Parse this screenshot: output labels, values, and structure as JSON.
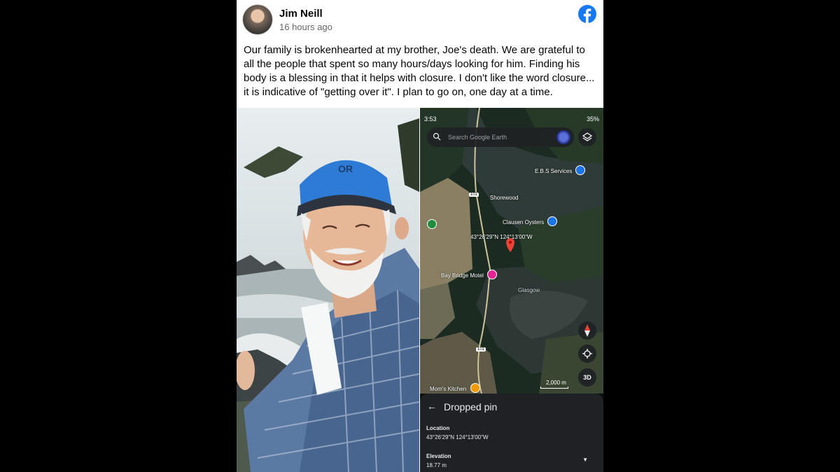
{
  "post": {
    "author": "Jim Neill",
    "timestamp": "16 hours ago",
    "text": "Our family is brokenhearted at my brother, Joe's death. We are grateful to all the people that spent so many hours/days looking for him. Finding his body is a blessing in that it helps with closure. I don't like the word closure... it is indicative of \"getting over it\". I plan to go on, one day at a time.",
    "brand_color": "#1877f2"
  },
  "map": {
    "status_time": "3:53",
    "battery": "35%",
    "search_placeholder": "Search Google Earth",
    "labels": {
      "ebs": "E.B.S Services",
      "shorewood": "Shorewood",
      "clausen": "Clausen Oysters",
      "coords": "43°26'29\"N 124°13'00\"W",
      "motel": "Bay Bridge Motel",
      "glasgow": "Glasgow",
      "moms": "Mom's Kitchen",
      "route1": "101",
      "route2": "101"
    },
    "scale": "2,000 m",
    "btn_3d": "3D"
  },
  "sheet": {
    "title": "Dropped pin",
    "location_label": "Location",
    "location_value": "43°26'29\"N 124°13'00\"W",
    "elevation_label": "Elevation",
    "elevation_value": "18.77 m"
  }
}
